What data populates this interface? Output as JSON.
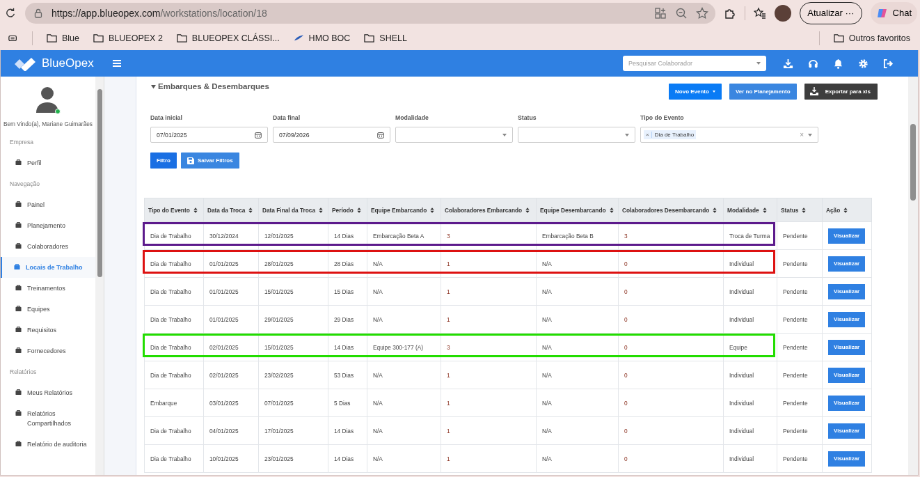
{
  "browser": {
    "url_host": "https://app.blueopex.com",
    "url_path": "/workstations/location/18",
    "update_button": "Atualizar",
    "update_more": "···",
    "chat_button": "Chat",
    "bookmarks": [
      {
        "label": "Blue",
        "kind": "folder"
      },
      {
        "label": "BLUEOPEX 2",
        "kind": "folder"
      },
      {
        "label": "BLUEOPEX CLÁSSI...",
        "kind": "folder"
      },
      {
        "label": "HMO BOC",
        "kind": "site"
      },
      {
        "label": "SHELL",
        "kind": "folder"
      }
    ],
    "other_favorites": "Outros favoritos"
  },
  "app": {
    "brand": "BlueOpex",
    "search": {
      "placeholder": "Pesquisar Colaborador"
    }
  },
  "sidebar": {
    "welcome": "Bem Vindo(a), Mariane Guimarães",
    "online": true,
    "sections": [
      {
        "title": "Empresa",
        "items": [
          {
            "label": "Perfil",
            "selected": false
          }
        ]
      },
      {
        "title": "Navegação",
        "items": [
          {
            "label": "Painel",
            "selected": false
          },
          {
            "label": "Planejamento",
            "selected": false
          },
          {
            "label": "Colaboradores",
            "selected": false
          },
          {
            "label": "Locais de Trabalho",
            "selected": true
          },
          {
            "label": "Treinamentos",
            "selected": false
          },
          {
            "label": "Equipes",
            "selected": false
          },
          {
            "label": "Requisitos",
            "selected": false
          },
          {
            "label": "Fornecedores",
            "selected": false
          }
        ]
      },
      {
        "title": "Relatórios",
        "items": [
          {
            "label": "Meus Relatórios",
            "selected": false
          },
          {
            "label": "Relatórios Compartilhados",
            "selected": false
          },
          {
            "label": "Relatório de auditoria",
            "selected": false
          }
        ]
      }
    ]
  },
  "panel": {
    "title": "Embarques & Desembarques",
    "expanded": true,
    "buttons": {
      "new_event": "Novo Evento",
      "plan": "Ver no Planejamento",
      "export": "Exportar para xls",
      "filter": "Filtro",
      "save": "Salvar Filtros"
    },
    "filters": [
      {
        "label": "Data inicial",
        "kind": "date",
        "value": "07/01/2025"
      },
      {
        "label": "Data final",
        "kind": "date",
        "value": "07/09/2026"
      },
      {
        "label": "Modalidade",
        "kind": "select"
      },
      {
        "label": "Status",
        "kind": "select"
      },
      {
        "label": "Tipo do Evento",
        "kind": "tags",
        "tags": [
          {
            "label": "Dia de Trabalho",
            "remove": "×"
          }
        ],
        "clear": "×"
      }
    ]
  },
  "table": {
    "columns": [
      "Tipo do Evento",
      "Data da Troca",
      "Data Final da Troca",
      "Período",
      "Equipe Embarcando",
      "Colaboradores Embarcando",
      "Equipe Desembarcando",
      "Colaboradores Desembarcando",
      "Modalidade",
      "Status",
      "Ação"
    ],
    "rows": [
      {
        "cells": [
          "Dia de Trabalho",
          "30/12/2024",
          "12/01/2025",
          "14 Dias",
          "Embarcação Beta A",
          "3",
          "Embarcação Beta B",
          "3",
          "Troca de Turma",
          "Pendente"
        ],
        "action": "Visualizar",
        "color": "#5c1a8c"
      },
      {
        "cells": [
          "Dia de Trabalho",
          "01/01/2025",
          "28/01/2025",
          "28 Dias",
          "N/A",
          "1",
          "N/A",
          "0",
          "Individual",
          "Pendente"
        ],
        "action": "Visualizar",
        "color": "#dd1111"
      },
      {
        "cells": [
          "Dia de Trabalho",
          "01/01/2025",
          "15/01/2025",
          "15 Dias",
          "N/A",
          "1",
          "N/A",
          "0",
          "Individual",
          "Pendente"
        ],
        "action": "Visualizar"
      },
      {
        "cells": [
          "Dia de Trabalho",
          "01/01/2025",
          "29/01/2025",
          "29 Dias",
          "N/A",
          "1",
          "N/A",
          "0",
          "Individual",
          "Pendente"
        ],
        "action": "Visualizar"
      },
      {
        "cells": [
          "Dia de Trabalho",
          "02/01/2025",
          "15/01/2025",
          "14 Dias",
          "Equipe 300-177 (A)",
          "3",
          "N/A",
          "0",
          "Equipe",
          "Pendente"
        ],
        "action": "Visualizar",
        "color": "#22dd00"
      },
      {
        "cells": [
          "Dia de Trabalho",
          "02/01/2025",
          "23/02/2025",
          "53 Dias",
          "N/A",
          "1",
          "N/A",
          "0",
          "Individual",
          "Pendente"
        ],
        "action": "Visualizar"
      },
      {
        "cells": [
          "Embarque",
          "03/01/2025",
          "07/01/2025",
          "5 Dias",
          "N/A",
          "1",
          "N/A",
          "0",
          "Individual",
          "Pendente"
        ],
        "action": "Visualizar"
      },
      {
        "cells": [
          "Dia de Trabalho",
          "04/01/2025",
          "17/01/2025",
          "14 Dias",
          "N/A",
          "1",
          "N/A",
          "0",
          "Individual",
          "Pendente"
        ],
        "action": "Visualizar"
      },
      {
        "cells": [
          "Dia de Trabalho",
          "10/01/2025",
          "23/01/2025",
          "14 Dias",
          "N/A",
          "1",
          "N/A",
          "0",
          "Individual",
          "Pendente"
        ],
        "action": "Visualizar"
      }
    ]
  }
}
